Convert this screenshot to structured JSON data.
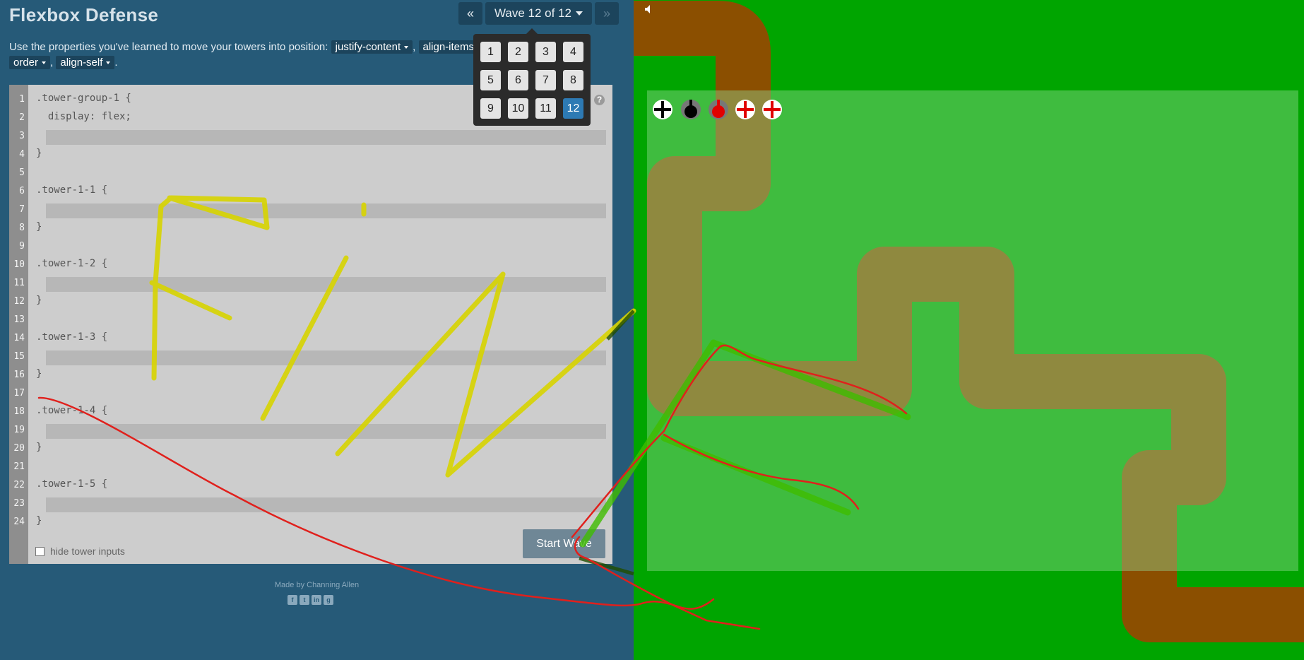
{
  "app": {
    "title": "Flexbox Defense",
    "wave_selector": {
      "prev_icon": "«",
      "label": "Wave 12 of 12",
      "next_icon": "»",
      "levels": [
        "1",
        "2",
        "3",
        "4",
        "5",
        "6",
        "7",
        "8",
        "9",
        "10",
        "11",
        "12"
      ],
      "active_level": "12"
    }
  },
  "instructions": {
    "text": "Use the properties you've learned to move your towers into position:",
    "properties": [
      "justify-content",
      "align-items",
      "order",
      "align-self"
    ]
  },
  "editor": {
    "line_numbers": [
      "1",
      "2",
      "3",
      "4",
      "5",
      "6",
      "7",
      "8",
      "9",
      "10",
      "11",
      "12",
      "13",
      "14",
      "15",
      "16",
      "17",
      "18",
      "19",
      "20",
      "21",
      "22",
      "23",
      "24"
    ],
    "lines": [
      ".tower-group-1 {",
      "  display: flex;",
      "",
      "}",
      "",
      ".tower-1-1 {",
      "",
      "}",
      "",
      ".tower-1-2 {",
      "",
      "}",
      "",
      ".tower-1-3 {",
      "",
      "}",
      "",
      ".tower-1-4 {",
      "",
      "}",
      "",
      ".tower-1-5 {",
      "",
      "}"
    ],
    "help_icon": "?",
    "hide_towers_label": "hide tower inputs",
    "start_wave_label": "Start Wave"
  },
  "footer": {
    "credit": "Made by Channing Allen",
    "social_icons": [
      "facebook-icon",
      "twitter-icon",
      "linkedin-icon",
      "github-icon"
    ]
  },
  "game": {
    "sound_icon": "speaker-icon",
    "towers": [
      {
        "name": "black-gun",
        "color": "#000000"
      },
      {
        "name": "black-bomb",
        "color": "#000000"
      },
      {
        "name": "red-bomb",
        "color": "#e00000"
      },
      {
        "name": "red-gun",
        "color": "#e00000"
      },
      {
        "name": "red-gun",
        "color": "#e00000"
      }
    ],
    "colors": {
      "grass": "#00a500",
      "path": "#8b4f00",
      "editor_bg": "#cdcdcd",
      "sidebar_bg": "#265a78",
      "active_level": "#2d7ab4"
    }
  }
}
